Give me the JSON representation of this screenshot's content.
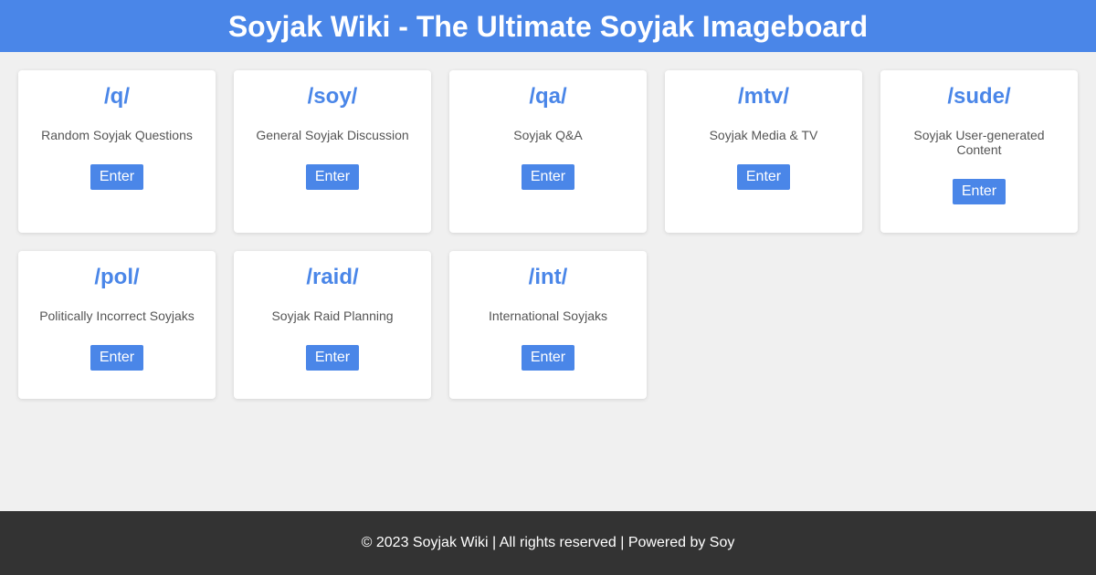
{
  "header": {
    "title": "Soyjak Wiki - The Ultimate Soyjak Imageboard"
  },
  "boards": [
    {
      "name": "/q/",
      "description": "Random Soyjak Questions",
      "button": "Enter"
    },
    {
      "name": "/soy/",
      "description": "General Soyjak Discussion",
      "button": "Enter"
    },
    {
      "name": "/qa/",
      "description": "Soyjak Q&A",
      "button": "Enter"
    },
    {
      "name": "/mtv/",
      "description": "Soyjak Media & TV",
      "button": "Enter"
    },
    {
      "name": "/sude/",
      "description": "Soyjak User-generated Content",
      "button": "Enter"
    },
    {
      "name": "/pol/",
      "description": "Politically Incorrect Soyjaks",
      "button": "Enter"
    },
    {
      "name": "/raid/",
      "description": "Soyjak Raid Planning",
      "button": "Enter"
    },
    {
      "name": "/int/",
      "description": "International Soyjaks",
      "button": "Enter"
    }
  ],
  "footer": {
    "text": "© 2023 Soyjak Wiki | All rights reserved | Powered by Soy"
  },
  "colors": {
    "accent": "#4a86e8",
    "background": "#f0f0f0",
    "footer": "#333333"
  }
}
